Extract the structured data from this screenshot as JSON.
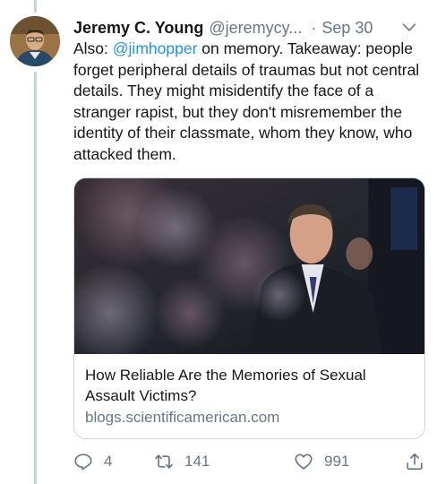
{
  "tweet": {
    "author_name": "Jeremy C. Young",
    "author_handle": "@jeremycy...",
    "separator": "·",
    "date": "Sep 30",
    "text_prefix": "Also: ",
    "mention": "@jimhopper",
    "text_suffix": " on memory. Takeaway: people forget peripheral details of traumas but not central details. They might misidentify the face of a stranger rapist, but they don't misremember the identity of their classmate, whom they know, who attacked them."
  },
  "card": {
    "title": "How Reliable Are the Memories of Sexual Assault Victims?",
    "domain": "blogs.scientificamerican.com"
  },
  "actions": {
    "replies": "4",
    "retweets": "141",
    "likes": "991"
  },
  "icons": [
    "chevron-down-icon",
    "reply-icon",
    "retweet-icon",
    "heart-icon",
    "share-icon"
  ],
  "colors": {
    "link": "#1b95e0",
    "secondary_text": "#657786",
    "thread_line": "#c9d2d9",
    "card_border": "#ccd6dd"
  }
}
